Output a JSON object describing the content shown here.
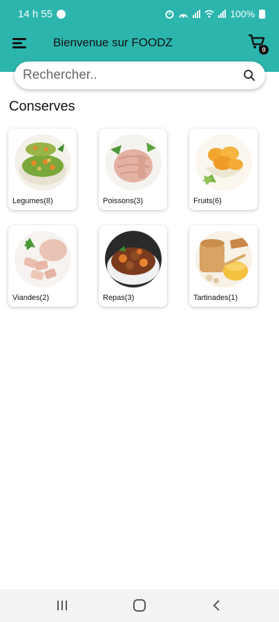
{
  "status_bar": {
    "time": "14 h 55",
    "battery": "100%"
  },
  "app_bar": {
    "title": "Bienvenue sur FOODZ",
    "cart_count": "0"
  },
  "search": {
    "placeholder": "Rechercher.."
  },
  "section": {
    "title": "Conserves"
  },
  "categories": [
    {
      "label": "Legumes(8)"
    },
    {
      "label": "Poissons(3)"
    },
    {
      "label": "Fruits(6)"
    },
    {
      "label": "Viandes(2)"
    },
    {
      "label": "Repas(3)"
    },
    {
      "label": "Tartinades(1)"
    }
  ],
  "colors": {
    "accent": "#2bb5ad"
  }
}
